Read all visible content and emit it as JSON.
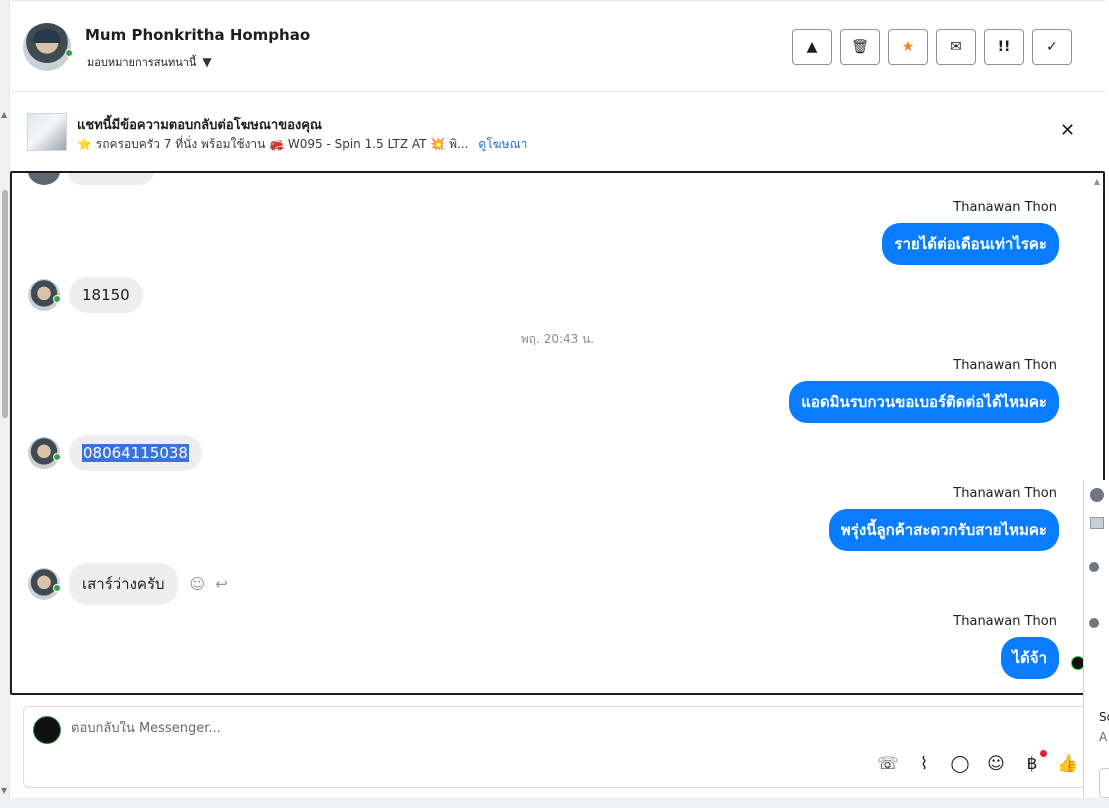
{
  "header": {
    "contact_name": "Mum Phonkritha Homphao",
    "assign_label": "มอบหมายการสนทนานี้",
    "toolbar": [
      {
        "name": "report-spam-button",
        "icon": "warning-icon",
        "glyph": "▲"
      },
      {
        "name": "delete-button",
        "icon": "trash-icon",
        "glyph": "🗑"
      },
      {
        "name": "star-button",
        "icon": "star-icon",
        "glyph": "★"
      },
      {
        "name": "mark-unread-button",
        "icon": "envelope-icon",
        "glyph": "✉"
      },
      {
        "name": "follow-up-button",
        "icon": "follow-up-icon",
        "glyph": "‼"
      },
      {
        "name": "mark-done-button",
        "icon": "check-icon",
        "glyph": "✓"
      }
    ]
  },
  "ad_banner": {
    "title": "แชทนี้มีข้อความตอบกลับต่อโฆษณาของคุณ",
    "description": "⭐ รถครอบครัว 7 ที่นั่ง พร้อมใช้งาน 🚒 W095 - Spin 1.5 LTZ AT 💥 พิ...",
    "link": "ดูโฆษณา"
  },
  "conversation": {
    "timestamp": "พฤ. 20:43 น.",
    "messages": [
      {
        "id": "m1",
        "direction": "out",
        "sender": "Thanawan Thon",
        "text": "รายได้ต่อเดือนเท่าไรคะ"
      },
      {
        "id": "m2",
        "direction": "in",
        "text": "18150"
      },
      {
        "id": "m3",
        "direction": "out",
        "sender": "Thanawan Thon",
        "text": "แอดมินรบกวนขอเบอร์ติดต่อได้ไหมคะ"
      },
      {
        "id": "m4",
        "direction": "in",
        "text": "08064115038",
        "selected": true
      },
      {
        "id": "m5",
        "direction": "out",
        "sender": "Thanawan Thon",
        "text": "พรุ่งนี้ลูกค้าสะดวกรับสายไหมคะ"
      },
      {
        "id": "m6",
        "direction": "in",
        "text": "เสาร์ว่างครับ"
      },
      {
        "id": "m7",
        "direction": "out",
        "sender": "Thanawan Thon",
        "text": "ได้จ้า"
      }
    ]
  },
  "reply": {
    "placeholder": "ตอบกลับใน Messenger...",
    "tools": [
      "call-add-icon",
      "paperclip-icon",
      "saved-reply-icon",
      "emoji-icon",
      "baht-payment-icon",
      "thumbs-up-icon"
    ]
  },
  "side_fragment": {
    "text_1": "So",
    "text_2": "A"
  },
  "colors": {
    "outgoing_bubble": "#0a7cff",
    "incoming_bubble": "#eeeeee",
    "accent_star": "#f5841f",
    "link": "#216fdb"
  }
}
